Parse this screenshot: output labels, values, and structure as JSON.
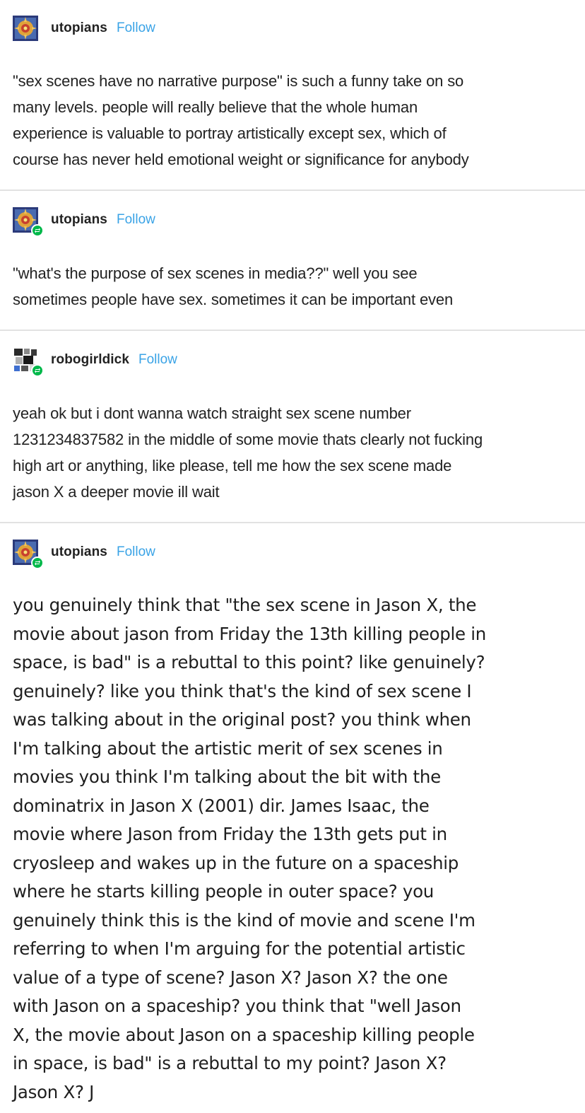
{
  "posts": [
    {
      "username": "utopians",
      "follow_label": "Follow",
      "avatar_icon": "utopians-avatar-icon",
      "is_reblog": false,
      "text": "\"sex scenes have no narrative purpose\" is such a funny take on so\nmany levels. people will really believe that the whole human\nexperience is valuable to portray artistically except sex, which of\ncourse has never held emotional weight or significance for anybody"
    },
    {
      "username": "utopians",
      "follow_label": "Follow",
      "avatar_icon": "utopians-avatar-icon",
      "is_reblog": true,
      "text": "\"what's the purpose of sex scenes in media??\" well you see\nsometimes people have sex. sometimes it can be important even"
    },
    {
      "username": "robogirldick",
      "follow_label": "Follow",
      "avatar_icon": "robogirldick-avatar-icon",
      "is_reblog": true,
      "text": "yeah ok but i dont wanna watch straight sex scene number\n1231234837582 in the middle of some movie thats clearly not fucking\nhigh art or anything, like please, tell me how the sex scene made\njason X a deeper movie ill wait"
    },
    {
      "username": "utopians",
      "follow_label": "Follow",
      "avatar_icon": "utopians-avatar-icon",
      "is_reblog": true,
      "text": "you genuinely think that \"the sex scene in Jason X, the\nmovie about jason from Friday the 13th killing people in\nspace, is bad\" is a rebuttal to this point? like genuinely?\ngenuinely? like you think that's the kind of sex scene I\nwas talking about in the original post? you think when\nI'm talking about the artistic merit of sex scenes in\nmovies you think I'm talking about the bit with the\ndominatrix in Jason X (2001) dir. James Isaac, the\nmovie where Jason from Friday the 13th gets put in\ncryosleep and wakes up in the future on a spaceship\nwhere he starts killing people in outer space? you\ngenuinely think this is the kind of movie and scene I'm\nreferring to when I'm arguing for the potential artistic\nvalue of a type of scene? Jason X? Jason X? the one\nwith Jason on a spaceship? you think that \"well Jason\nX, the movie about Jason on a spaceship killing people\nin space, is bad\" is a rebuttal to my point? Jason X?\nJason X? J"
    }
  ],
  "colors": {
    "follow": "#3aa3e6",
    "reblog_badge": "#00b84a",
    "divider": "#e2e2e2",
    "text": "#222222"
  }
}
